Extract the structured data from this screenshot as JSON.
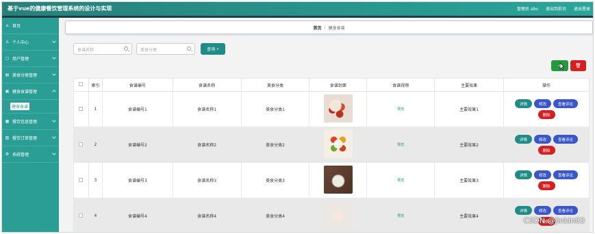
{
  "header": {
    "title": "基于vue的健康餐饮管理系统的设计与实现",
    "admin_label": "管理员 abo",
    "exit_to_front": "退出到前台",
    "logout": "退出登录"
  },
  "sidebar": {
    "items": [
      {
        "label": "首页",
        "icon": "home-icon"
      },
      {
        "label": "个人中心",
        "icon": "user-icon"
      },
      {
        "label": "用户管理",
        "icon": "users-icon"
      },
      {
        "label": "美食分类管理",
        "icon": "category-icon"
      },
      {
        "label": "健身食谱管理",
        "icon": "recipe-icon"
      },
      {
        "label": "餐饮信息管理",
        "icon": "info-icon"
      },
      {
        "label": "餐饮订单管理",
        "icon": "order-icon"
      },
      {
        "label": "系统管理",
        "icon": "settings-icon"
      }
    ],
    "active_sub": "健身食谱"
  },
  "breadcrumb": {
    "home": "首页",
    "separator": "/",
    "current": "健身食谱"
  },
  "search": {
    "name_placeholder": "食谱名称",
    "category_placeholder": "美食分类",
    "button_label": "查询"
  },
  "actions": {
    "add_label": "+",
    "delete_label": "🗑"
  },
  "table": {
    "headers": [
      "",
      "索引",
      "食谱编号",
      "食谱名称",
      "美食分类",
      "食谱封面",
      "食谱视频",
      "主要效果",
      "操作"
    ],
    "rows": [
      {
        "index": "1",
        "code": "食谱编号1",
        "name": "食谱名称1",
        "category": "美食分类1",
        "video": "预览",
        "effect": "主要效果1"
      },
      {
        "index": "2",
        "code": "食谱编号2",
        "name": "食谱名称2",
        "category": "美食分类2",
        "video": "预览",
        "effect": "主要效果2"
      },
      {
        "index": "3",
        "code": "食谱编号3",
        "name": "食谱名称3",
        "category": "美食分类3",
        "video": "预览",
        "effect": "主要效果3"
      },
      {
        "index": "4",
        "code": "食谱编号4",
        "name": "食谱名称4",
        "category": "美食分类4",
        "video": "预览",
        "effect": "主要效果4"
      }
    ],
    "ops": {
      "detail": "详情",
      "edit": "修改",
      "comment": "查看评论",
      "delete": "删除"
    }
  },
  "watermark": "CSDN @jinkin03",
  "colors": {
    "brand_teal": "#2a9e95",
    "header_teal": "#26807a",
    "primary_blue": "#3a56c8",
    "danger_red": "#d42020",
    "success_green": "#239a3e"
  }
}
